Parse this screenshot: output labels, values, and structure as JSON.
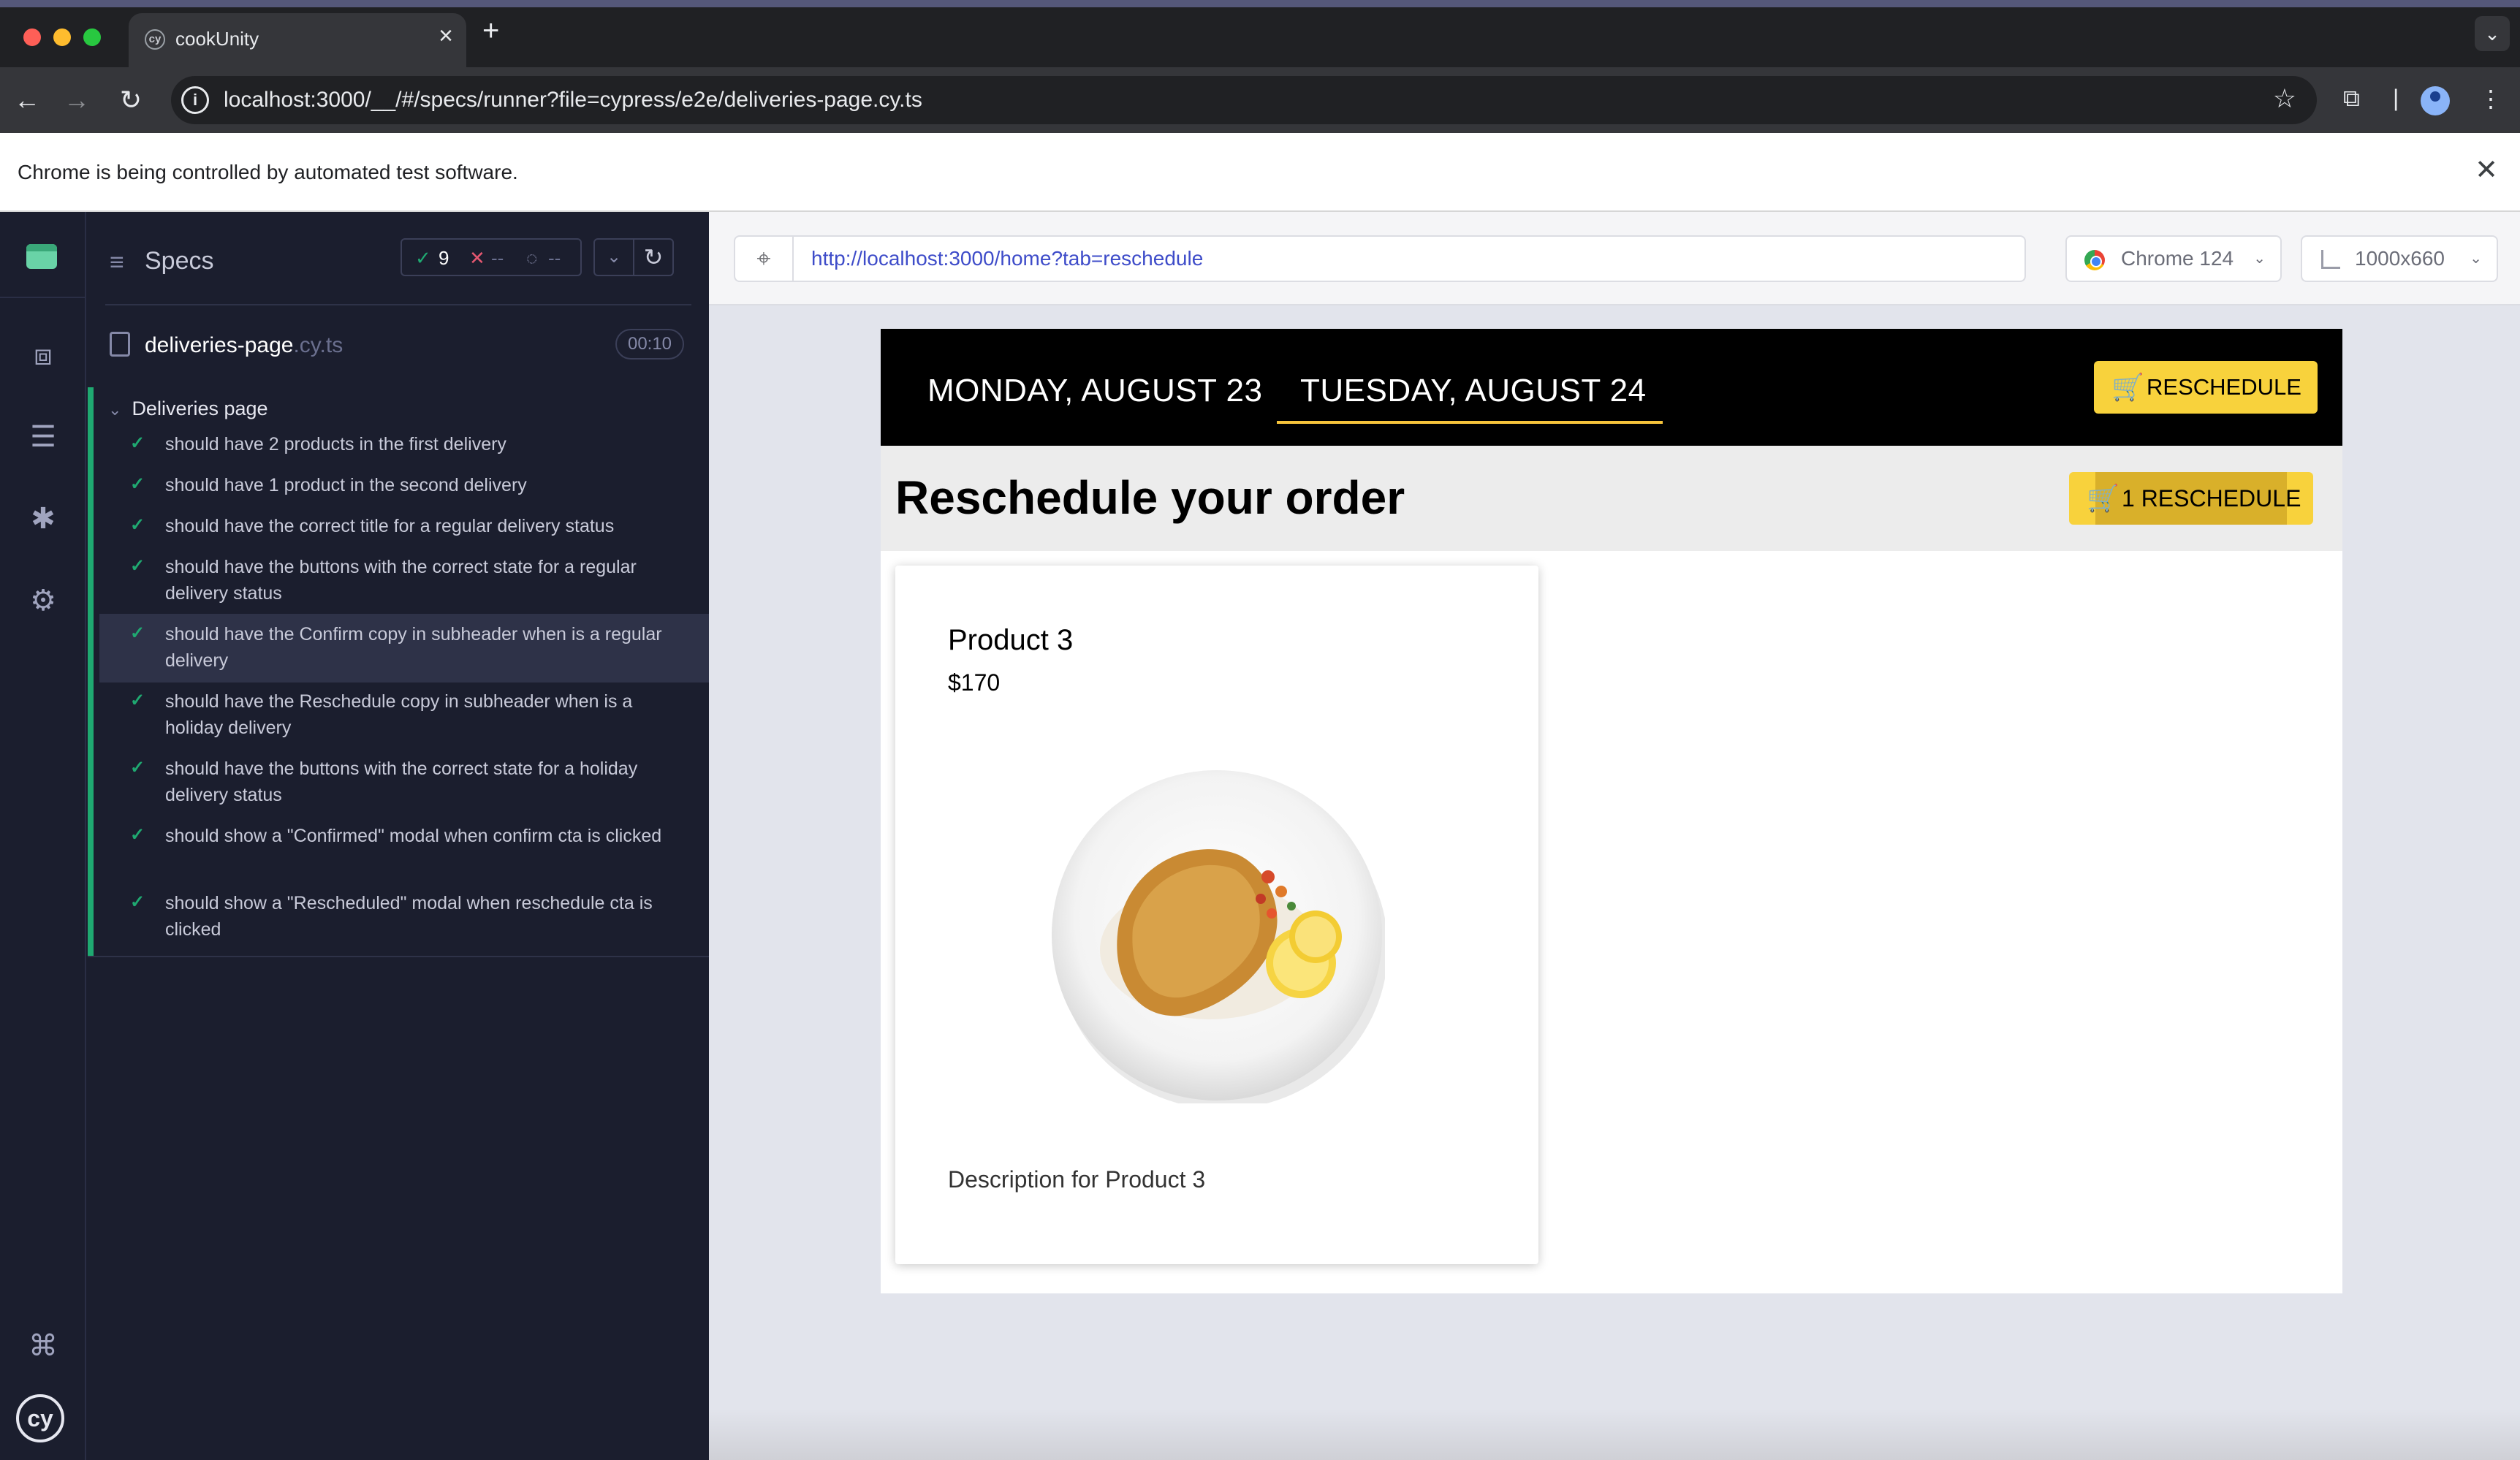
{
  "browser": {
    "tab_title": "cookUnity",
    "tab_favicon": "cy",
    "new_tab": "+",
    "tab_close": "×",
    "address_url": "localhost:3000/__/#/specs/runner?file=cypress/e2e/deliveries-page.cy.ts",
    "infobar_message": "Chrome is being controlled by automated test software.",
    "infobar_close": "✕"
  },
  "reporter": {
    "header_title": "Specs",
    "passed_count": "9",
    "failed_count": "--",
    "pending_count": "--",
    "spec_name": "deliveries-page",
    "spec_ext": ".cy.ts",
    "spec_duration": "00:10",
    "suite_title": "Deliveries page",
    "tests": [
      {
        "title": "should have 2 products in the first delivery",
        "state": "passed"
      },
      {
        "title": "should have 1 product in the second delivery",
        "state": "passed"
      },
      {
        "title": "should have the correct title for a regular delivery status",
        "state": "passed"
      },
      {
        "title": "should have the buttons with the correct state for a regular delivery status",
        "state": "passed"
      },
      {
        "title": "should have the Confirm copy in subheader when is a regular delivery",
        "state": "passed",
        "highlighted": true
      },
      {
        "title": "should have the Reschedule copy in subheader when is a holiday delivery",
        "state": "passed"
      },
      {
        "title": "should have the buttons with the correct state for a holiday delivery status",
        "state": "passed"
      },
      {
        "title": "should show a \"Confirmed\" modal when confirm cta is clicked",
        "state": "passed"
      },
      {
        "title": "should show a \"Rescheduled\" modal when reschedule cta is clicked",
        "state": "passed"
      }
    ]
  },
  "aut": {
    "url": "http://localhost:3000/home?tab=reschedule",
    "browser_label": "Chrome 124",
    "viewport_label": "1000x660"
  },
  "app": {
    "day_tabs": [
      "MONDAY, AUGUST 23",
      "TUESDAY, AUGUST 24"
    ],
    "active_tab": "TUESDAY, AUGUST 24",
    "nav_button_label": "RESCHEDULE",
    "subheader_title": "Reschedule your order",
    "subheader_button_label": "1 RESCHEDULE",
    "product": {
      "name": "Product 3",
      "price": "$170",
      "description": "Description for Product 3"
    }
  },
  "colors": {
    "accent_yellow": "#f8d23c",
    "pass_green": "#1fa971",
    "fail_red": "#e45770",
    "nav_bg": "#1b1e2e"
  },
  "icons": {
    "cart": "🛒",
    "check": "✓",
    "refresh": "↻"
  }
}
